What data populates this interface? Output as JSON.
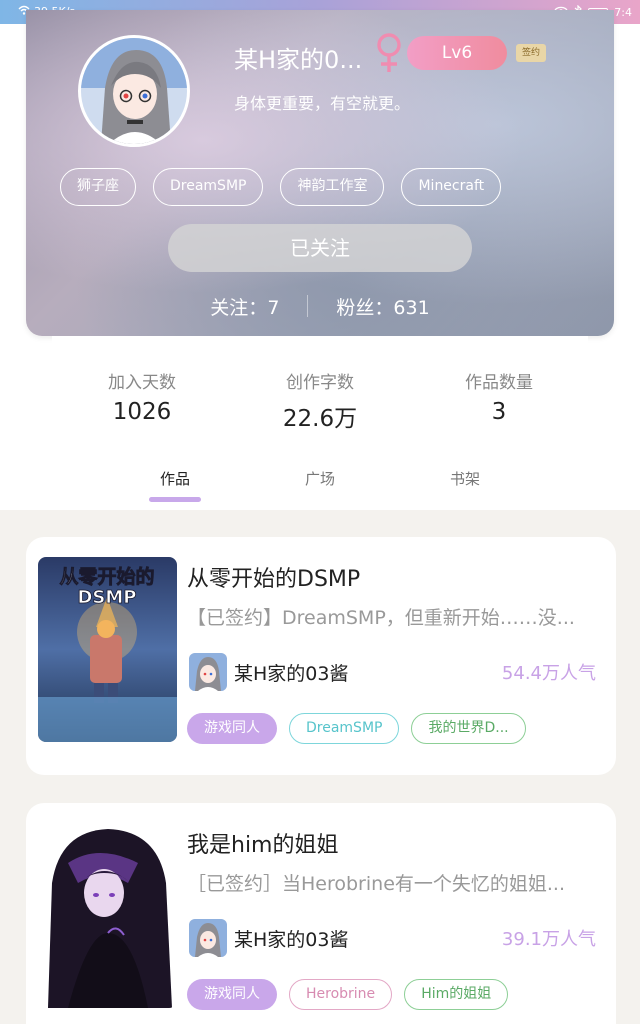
{
  "status_bar": {
    "network_speed": "39.5K/s",
    "time": "7:4"
  },
  "profile": {
    "username": "某H家的0...",
    "level": "Lv6",
    "signed_badge": "签约",
    "bio": "身体更重要，有空就更。",
    "tags": [
      "狮子座",
      "DreamSMP",
      "神韵工作室",
      "Minecraft"
    ],
    "follow_button": "已关注",
    "following_label": "关注：",
    "following_count": "7",
    "fans_label": "粉丝：",
    "fans_count": "631"
  },
  "stats": {
    "days_label": "加入天数",
    "days_value": "1026",
    "words_label": "创作字数",
    "words_value": "22.6万",
    "works_label": "作品数量",
    "works_value": "3"
  },
  "tabs": [
    {
      "label": "作品",
      "active": true
    },
    {
      "label": "广场",
      "active": false
    },
    {
      "label": "书架",
      "active": false
    }
  ],
  "books": [
    {
      "title": "从零开始的DSMP",
      "desc": "【已签约】DreamSMP，但重新开始……没...",
      "author": "某H家的03酱",
      "popularity": "54.4万人气",
      "cover_text_line1": "从零开始的",
      "cover_text_line2": "DSMP",
      "tags": [
        {
          "label": "游戏同人",
          "style": "filled"
        },
        {
          "label": "DreamSMP",
          "style": "cyan"
        },
        {
          "label": "我的世界D...",
          "style": "green"
        }
      ]
    },
    {
      "title": "我是him的姐姐",
      "desc": "［已签约］当Herobrine有一个失忆的姐姐...",
      "author": "某H家的03酱",
      "popularity": "39.1万人气",
      "tags": [
        {
          "label": "游戏同人",
          "style": "filled"
        },
        {
          "label": "Herobrine",
          "style": "pink"
        },
        {
          "label": "Him的姐姐",
          "style": "green"
        }
      ]
    }
  ],
  "colors": {
    "accent_purple": "#c9a7ea",
    "level_pink": "#f29ec6",
    "gender_pink": "#f08cb0"
  }
}
